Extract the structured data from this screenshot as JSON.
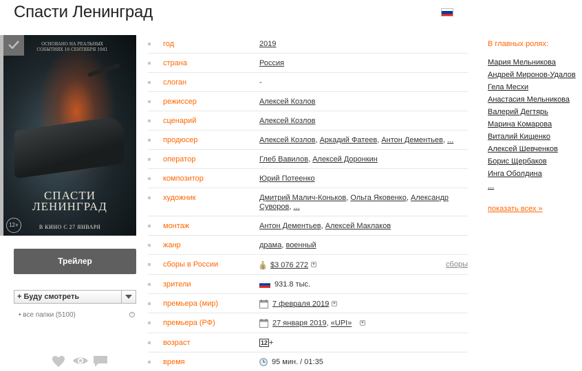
{
  "page": {
    "title": "Спасти Ленинград",
    "flag_colors": [
      "#ffffff",
      "#0039a6",
      "#d52b1e"
    ]
  },
  "poster": {
    "tagline": "ОСНОВАНО НА РЕАЛЬНЫХ СОБЫТИЯХ 16 СЕНТЯБРЯ 1941",
    "name_line1": "СПАСТИ",
    "name_line2": "ЛЕНИНГРАД",
    "release": "В КИНО С 27 ЯНВАРЯ",
    "age": "12+"
  },
  "trailer_button": "Трейлер",
  "folder_select": {
    "label": "+ Буду смотреть",
    "all_folders": "все папки (5100)"
  },
  "info": {
    "year": {
      "key": "год",
      "value": "2019"
    },
    "country": {
      "key": "страна",
      "value": "Россия"
    },
    "slogan": {
      "key": "слоган",
      "value": "-"
    },
    "director": {
      "key": "режиссер",
      "value": "Алексей Козлов"
    },
    "writer": {
      "key": "сценарий",
      "value": "Алексей Козлов"
    },
    "producer": {
      "key": "продюсер",
      "values": [
        "Алексей Козлов",
        "Аркадий Фатеев",
        "Антон Дементьев",
        "..."
      ]
    },
    "operator": {
      "key": "оператор",
      "values": [
        "Глеб Вавилов",
        "Алексей Доронкин"
      ]
    },
    "composer": {
      "key": "композитор",
      "value": "Юрий Потеенко"
    },
    "artist": {
      "key": "художник",
      "values": [
        "Дмитрий Малич-Коньков",
        "Ольга Яковенко",
        "Александр Суворов",
        "..."
      ]
    },
    "editing": {
      "key": "монтаж",
      "values": [
        "Антон Дементьев",
        "Алексей Маклаков"
      ]
    },
    "genre": {
      "key": "жанр",
      "values": [
        "драма",
        "военный"
      ]
    },
    "box_office": {
      "key": "сборы в России",
      "value": "$3 076 272",
      "link": "сборы"
    },
    "viewers": {
      "key": "зрители",
      "value": "931.8 тыс."
    },
    "premiere_world": {
      "key": "премьера (мир)",
      "value": "7 февраля 2019"
    },
    "premiere_rf": {
      "key": "премьера (РФ)",
      "value": "27 января 2019",
      "distributor": "«UPI»"
    },
    "age": {
      "key": "возраст",
      "value": "12",
      "suffix": "+"
    },
    "time": {
      "key": "время",
      "value": "95 мин. / 01:35"
    }
  },
  "cast": {
    "heading": "В главных ролях:",
    "actors": [
      "Мария Мельникова",
      "Андрей Миронов-Удалов",
      "Гела Месхи",
      "Анастасия Мельникова",
      "Валерий Дегтярь",
      "Марина Комарова",
      "Виталий Кищенко",
      "Алексей Шевченков",
      "Борис Щербаков",
      "Инга Оболдина",
      "..."
    ],
    "show_all": "показать всех »"
  }
}
